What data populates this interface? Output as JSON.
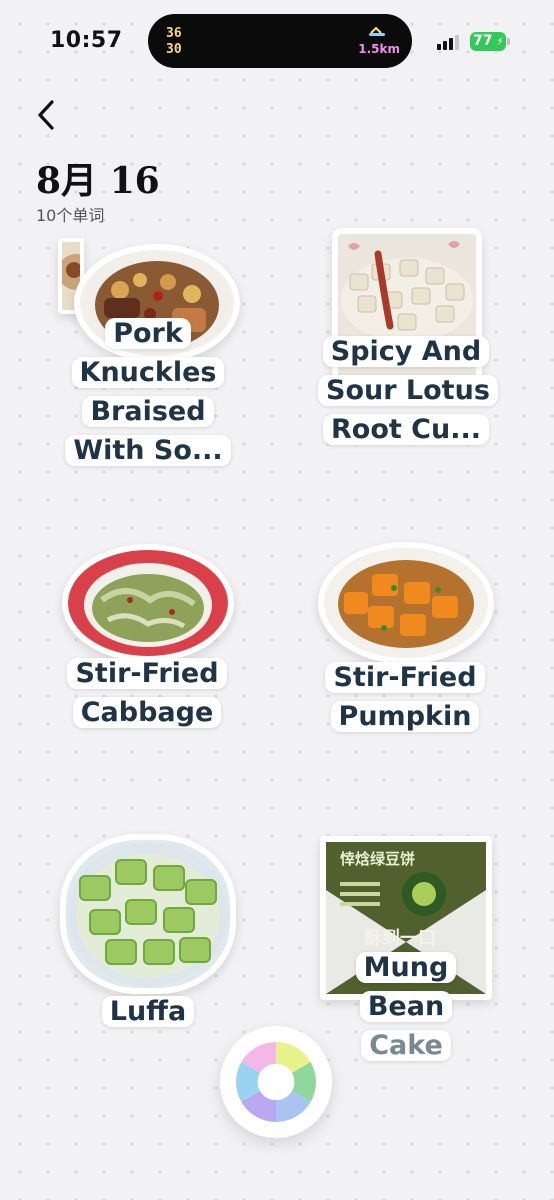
{
  "status_bar": {
    "time": "10:57",
    "island_numbers": [
      "36",
      "30"
    ],
    "distance": "1.5km",
    "battery": "77"
  },
  "header": {
    "title": "8月 16",
    "subtitle": "10个单词"
  },
  "words": [
    {
      "label": "Pork Knuckles Braised With So..."
    },
    {
      "label": "Spicy And Sour Lotus Root Cu..."
    },
    {
      "label": "Stir-Fried Cabbage"
    },
    {
      "label": "Stir-Fried Pumpkin"
    },
    {
      "label": "Luffa"
    },
    {
      "label_line1": "Mung",
      "label_line2": "Bean",
      "label_line3": "Cake",
      "package_text": "悻焓绿豆饼",
      "package_text2": "酥到一口"
    }
  ],
  "icons": {
    "back": "chevron-left-icon",
    "fab": "camera-shutter-icon"
  }
}
